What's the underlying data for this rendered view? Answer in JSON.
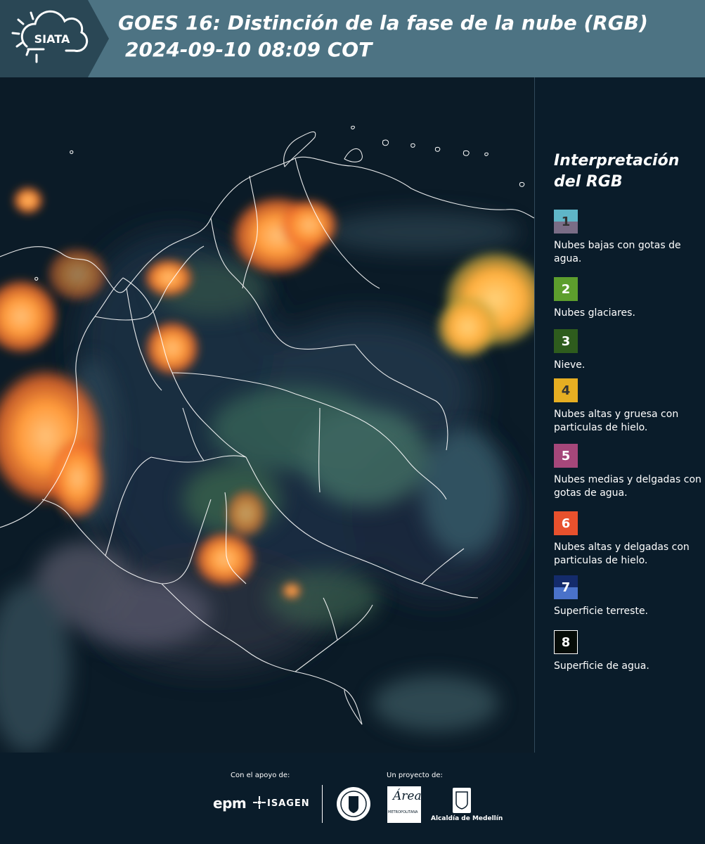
{
  "header": {
    "logo_text": "SIATA",
    "title_line1": "GOES 16: Distinción de la fase de la nube (RGB)",
    "title_line2": "2024-09-10 08:09 COT"
  },
  "legend": {
    "title_line1": "Interpretación",
    "title_line2": "del RGB",
    "items": [
      {
        "num": "1",
        "label": "Nubes bajas con gotas de agua.",
        "color_top": "#5fb6c8",
        "color_bottom": "#7a6d86",
        "text_color": "#333333"
      },
      {
        "num": "2",
        "label": "Nubes glaciares.",
        "color_top": "#5d9e2d",
        "color_bottom": "#5d9e2d",
        "text_color": "#ffffff"
      },
      {
        "num": "3",
        "label": "Nieve.",
        "color_top": "#2e5c1d",
        "color_bottom": "#2e5c1d",
        "text_color": "#ffffff"
      },
      {
        "num": "4",
        "label": "Nubes altas y gruesa con particulas de hielo.",
        "color_top": "#e6ae22",
        "color_bottom": "#e6ae22",
        "text_color": "#333333"
      },
      {
        "num": "5",
        "label": "Nubes medias y delgadas con gotas de agua.",
        "color_top": "#a5477a",
        "color_bottom": "#a5477a",
        "text_color": "#ffffff"
      },
      {
        "num": "6",
        "label": "Nubes altas y delgadas con particulas de hielo.",
        "color_top": "#e8512d",
        "color_bottom": "#e8512d",
        "text_color": "#ffffff"
      },
      {
        "num": "7",
        "label": "Superficie terreste.",
        "color_top": "#142b6b",
        "color_bottom": "#4a72c9",
        "text_color": "#ffffff"
      },
      {
        "num": "8",
        "label": "Superficie de agua.",
        "color_top": "#060c08",
        "color_bottom": "#060c08",
        "text_color": "#ffffff"
      }
    ]
  },
  "footer": {
    "support_label": "Con el apoyo de:",
    "project_label": "Un proyecto de:",
    "brand_epm": "epm",
    "brand_isagen": "ISAGEN",
    "brand_area_name": "Área",
    "brand_area_sub": "METROPOLITANA",
    "brand_alcaldia": "Alcaldía de Medellín"
  }
}
